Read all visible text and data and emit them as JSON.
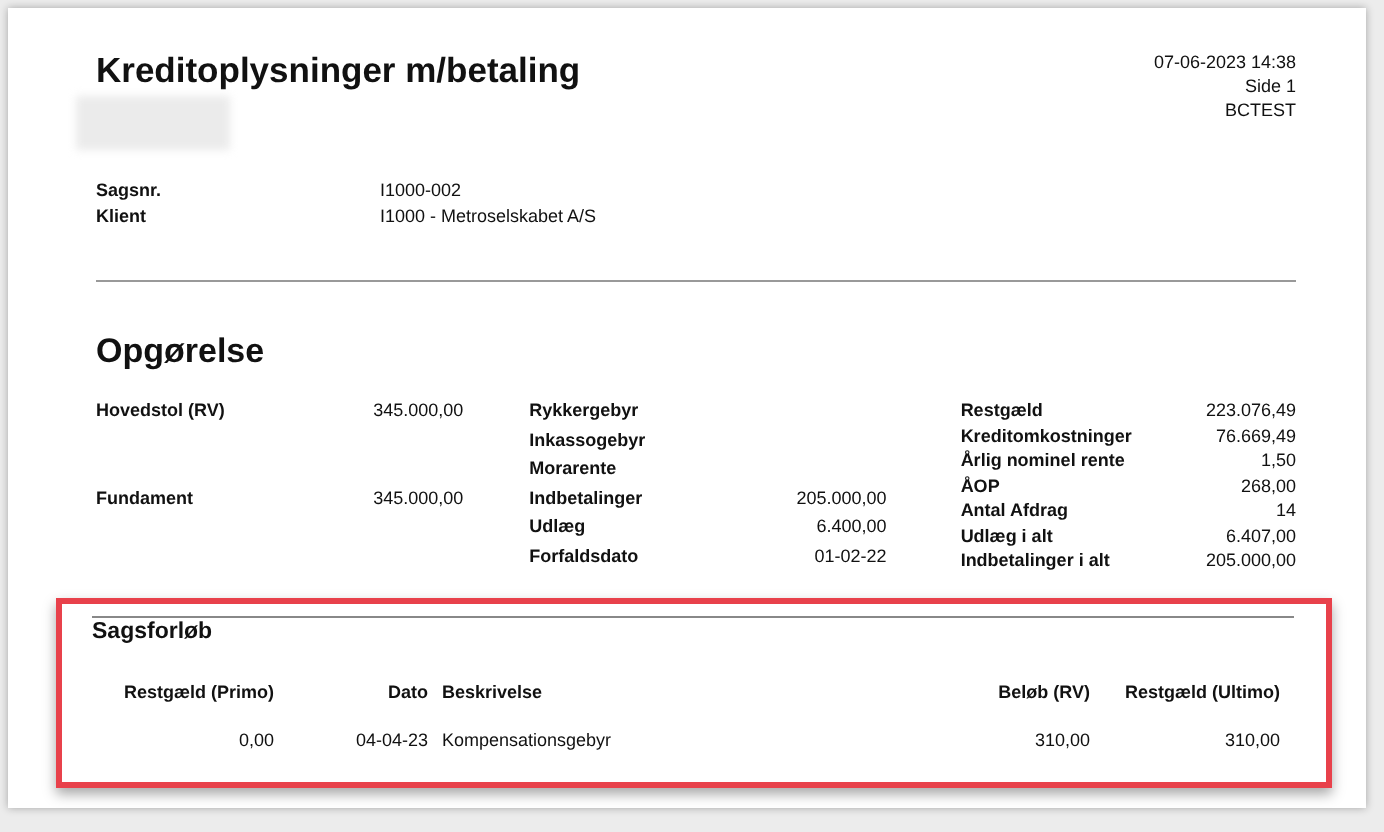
{
  "report": {
    "title": "Kreditoplysninger m/betaling",
    "meta": [
      "07-06-2023 14:38",
      "Side 1",
      "BCTEST"
    ],
    "redacted": true
  },
  "case_info": [
    {
      "label": "Sagsnr.",
      "value": "I1000-002"
    },
    {
      "label": "Klient",
      "value": "I1000 - Metroselskabet A/S"
    }
  ],
  "summary": {
    "title": "Opgørelse",
    "columns": [
      [
        {
          "label": "Hovedstol (RV)",
          "value": "345.000,00"
        },
        {
          "label": "Fundament",
          "value": "345.000,00"
        }
      ],
      [
        {
          "label": "Rykkergebyr"
        },
        {
          "label": "Inkassogebyr"
        },
        {
          "label": "Morarente"
        },
        {
          "label": "Indbetalinger",
          "value": "205.000,00"
        },
        {
          "label": "Udlæg",
          "value": "6.400,00"
        },
        {
          "label": "Forfaldsdato",
          "value": "01-02-22"
        }
      ],
      [
        {
          "label": "Restgæld",
          "value": "223.076,49"
        },
        {
          "label": "Kreditomkostninger",
          "value": "76.669,49"
        },
        {
          "label": "Årlig nominel rente",
          "value": "1,50"
        },
        {
          "label": "ÅOP",
          "value": "268,00"
        },
        {
          "label": "Antal Afdrag",
          "value": "14"
        },
        {
          "label": "Udlæg i alt",
          "value": "6.407,00"
        },
        {
          "label": "Indbetalinger i alt",
          "value": "205.000,00"
        }
      ]
    ]
  },
  "history": {
    "title": "Sagsforløb",
    "highlighted": true,
    "columns": [
      "Restgæld (Primo)",
      "Dato",
      "Beskrivelse",
      "Beløb (RV)",
      "Restgæld (Ultimo)"
    ],
    "rows": [
      [
        "0,00",
        "04-04-23",
        "Kompensationsgebyr",
        "310,00",
        "310,00"
      ]
    ]
  }
}
